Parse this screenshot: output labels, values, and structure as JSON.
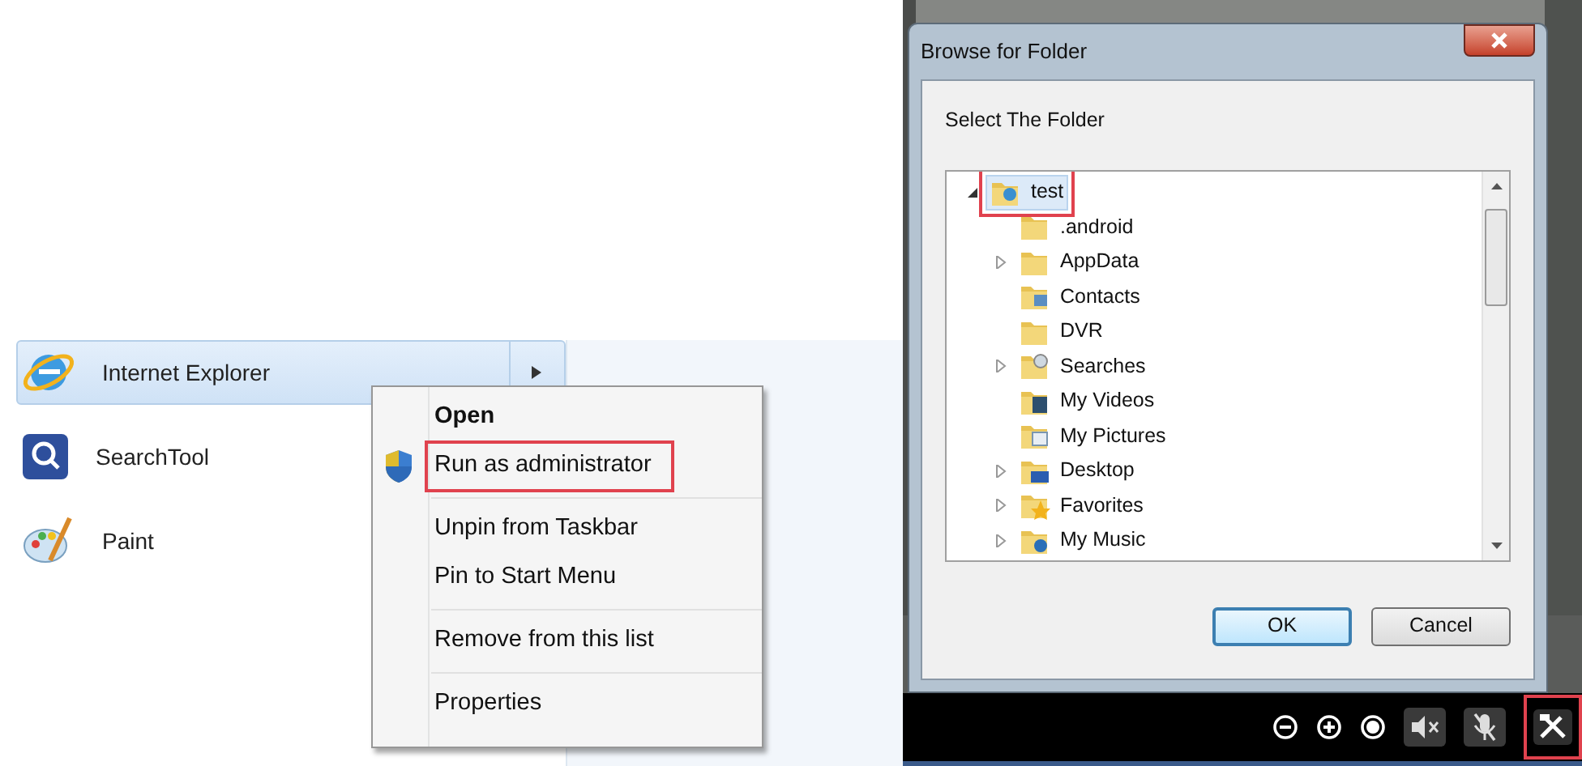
{
  "start_menu": {
    "items": [
      {
        "label": "Internet Explorer",
        "kind": "browser",
        "selected": true,
        "submenu": true
      },
      {
        "label": "SearchTool",
        "kind": "search",
        "selected": false,
        "submenu": false
      },
      {
        "label": "Paint",
        "kind": "paint",
        "selected": false,
        "submenu": false
      }
    ]
  },
  "context_menu": {
    "groups": [
      [
        {
          "label": "Open",
          "default": true,
          "shield": false,
          "highlighted": false
        },
        {
          "label": "Run as administrator",
          "default": false,
          "shield": true,
          "highlighted": true
        }
      ],
      [
        {
          "label": "Unpin from Taskbar",
          "default": false,
          "shield": false,
          "highlighted": false
        },
        {
          "label": "Pin to Start Menu",
          "default": false,
          "shield": false,
          "highlighted": false
        }
      ],
      [
        {
          "label": "Remove from this list",
          "default": false,
          "shield": false,
          "highlighted": false
        }
      ],
      [
        {
          "label": "Properties",
          "default": false,
          "shield": false,
          "highlighted": false
        }
      ]
    ]
  },
  "dialog": {
    "title": "Browse for Folder",
    "prompt": "Select The Folder",
    "tree": [
      {
        "label": "test",
        "kind": "user",
        "expanded": true,
        "selected": true,
        "highlighted": true,
        "children": [
          {
            "label": ".android",
            "kind": "plain",
            "selected": false,
            "highlighted": false
          },
          {
            "label": "AppData",
            "kind": "plain",
            "expanded": false,
            "selected": false,
            "highlighted": false
          },
          {
            "label": "Contacts",
            "kind": "contacts",
            "selected": false,
            "highlighted": false
          },
          {
            "label": "DVR",
            "kind": "plain",
            "selected": false,
            "highlighted": false
          },
          {
            "label": "Searches",
            "kind": "search",
            "expanded": false,
            "selected": false,
            "highlighted": false
          },
          {
            "label": "My Videos",
            "kind": "videos",
            "selected": false,
            "highlighted": false
          },
          {
            "label": "My Pictures",
            "kind": "pictures",
            "selected": false,
            "highlighted": false
          },
          {
            "label": "Desktop",
            "kind": "desktop",
            "expanded": false,
            "selected": false,
            "highlighted": false
          },
          {
            "label": "Favorites",
            "kind": "favorites",
            "expanded": false,
            "selected": false,
            "highlighted": false
          },
          {
            "label": "My Music",
            "kind": "music",
            "expanded": false,
            "selected": false,
            "highlighted": false
          }
        ]
      }
    ],
    "buttons": [
      {
        "label": "OK",
        "default": true
      },
      {
        "label": "Cancel",
        "default": false
      }
    ]
  },
  "control_bar": {
    "buttons": [
      {
        "kind": "zoom-out",
        "highlighted": false
      },
      {
        "kind": "zoom-in",
        "highlighted": false
      },
      {
        "kind": "record",
        "highlighted": false
      },
      {
        "kind": "mute",
        "highlighted": false
      },
      {
        "kind": "mic-off",
        "highlighted": false
      },
      {
        "kind": "tools",
        "highlighted": true
      }
    ]
  }
}
